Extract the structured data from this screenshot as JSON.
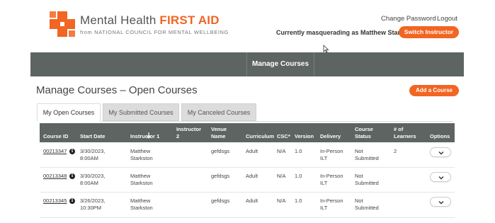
{
  "brand": {
    "title_main": "Mental Health ",
    "title_accent": "FIRST AID",
    "sub_prefix": "from ",
    "sub_org": "NATIONAL COUNCIL FOR MENTAL WELLBEING",
    "accent_color": "#f26522"
  },
  "header": {
    "change_password": "Change Password",
    "logout": "Logout",
    "masquerade_text": "Currently masquerading as Matthew Starkston",
    "switch_instructor": "Switch Instructor"
  },
  "nav": {
    "manage_courses": "Manage Courses"
  },
  "page": {
    "title": "Manage Courses – Open Courses",
    "add_course": "Add a Course"
  },
  "tabs": [
    {
      "label": "My Open Courses",
      "active": true
    },
    {
      "label": "My Submitted Courses",
      "active": false
    },
    {
      "label": "My Canceled Courses",
      "active": false
    }
  ],
  "table": {
    "columns": {
      "course_id": "Course ID",
      "start_date": "Start Date",
      "instructor1": "Instructor 1",
      "instructor2_a": "Instructor",
      "instructor2_b": "2",
      "venue_a": "Venue",
      "venue_b": "Name",
      "curriculum": "Curriculum",
      "csc": "CSC*",
      "version": "Version",
      "delivery": "Delivery",
      "status_a": "Course",
      "status_b": "Status",
      "learners_a": "# of",
      "learners_b": "Learners",
      "options": "Options"
    },
    "rows": [
      {
        "course_id": "00213347",
        "date": "3/30/2023,",
        "time": "8:00AM",
        "inst_first": "Matthew",
        "inst_last": "Starkston",
        "instructor2": "",
        "venue": "gefdsgs",
        "curriculum": "Adult",
        "csc": "N/A",
        "version": "1.0",
        "delivery_a": "In-Person",
        "delivery_b": "ILT",
        "status_a": "Not",
        "status_b": "Submitted",
        "learners": "2"
      },
      {
        "course_id": "00213348",
        "date": "3/30/2023,",
        "time": "8:00AM",
        "inst_first": "Matthew",
        "inst_last": "Starkston",
        "instructor2": "",
        "venue": "gefdsgs",
        "curriculum": "Adult",
        "csc": "N/A",
        "version": "1.0",
        "delivery_a": "In-Person",
        "delivery_b": "ILT",
        "status_a": "Not",
        "status_b": "Submitted",
        "learners": ""
      },
      {
        "course_id": "00213345",
        "date": "3/26/2023,",
        "time": "10:30PM",
        "inst_first": "Matthew",
        "inst_last": "Starkston",
        "instructor2": "",
        "venue": "gefdsgs",
        "curriculum": "Adult",
        "csc": "N/A",
        "version": "1.0",
        "delivery_a": "In-Person",
        "delivery_b": "ILT",
        "status_a": "Not",
        "status_b": "Submitted",
        "learners": ""
      }
    ]
  }
}
